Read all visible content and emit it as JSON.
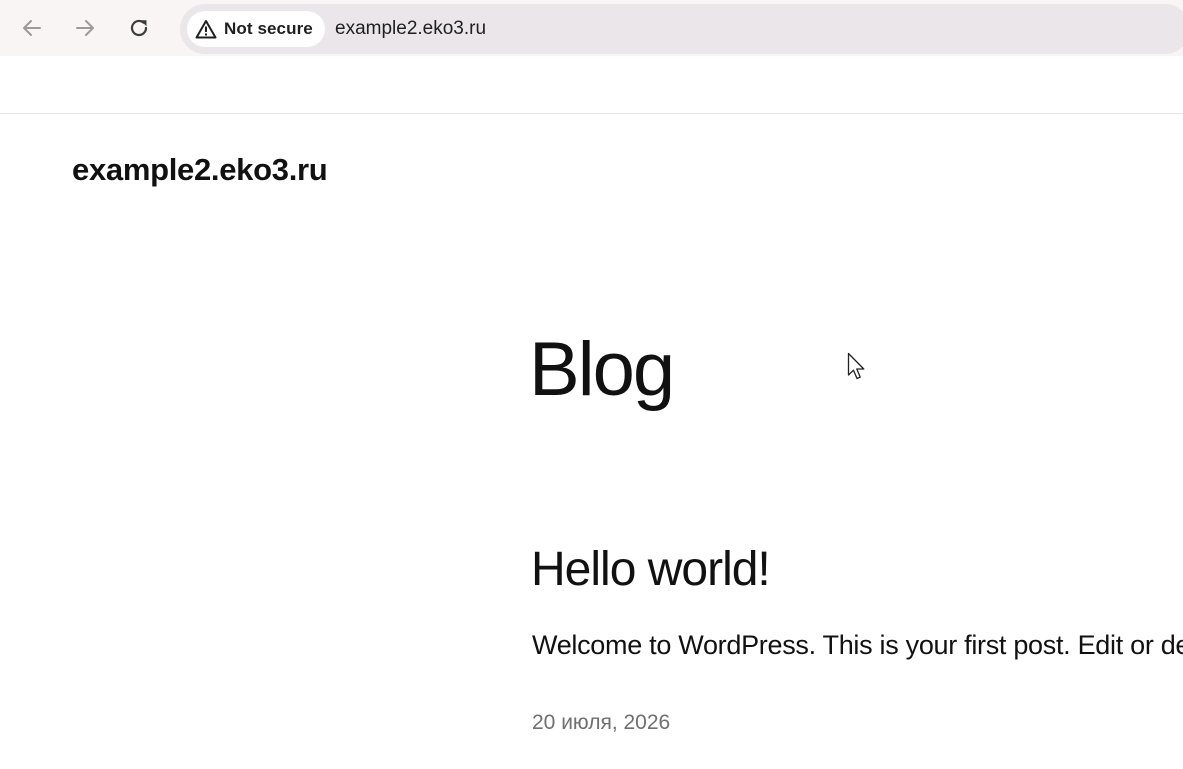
{
  "browser": {
    "security_label": "Not secure",
    "url": "example2.eko3.ru",
    "icons": {
      "back": "arrow-left-icon",
      "forward": "arrow-right-icon",
      "reload": "reload-icon",
      "security": "warning-triangle-icon"
    }
  },
  "site": {
    "title": "example2.eko3.ru"
  },
  "page": {
    "heading": "Blog"
  },
  "posts": [
    {
      "title": "Hello world!",
      "excerpt": "Welcome to WordPress. This is your first post. Edit or delete it, then start writing!",
      "date": "20 июля, 2026"
    }
  ],
  "colors": {
    "text": "#111111",
    "muted": "#6f6f6f",
    "toolbar_bg": "#f9f5f5",
    "omnibox_bg": "#eae6ea"
  }
}
